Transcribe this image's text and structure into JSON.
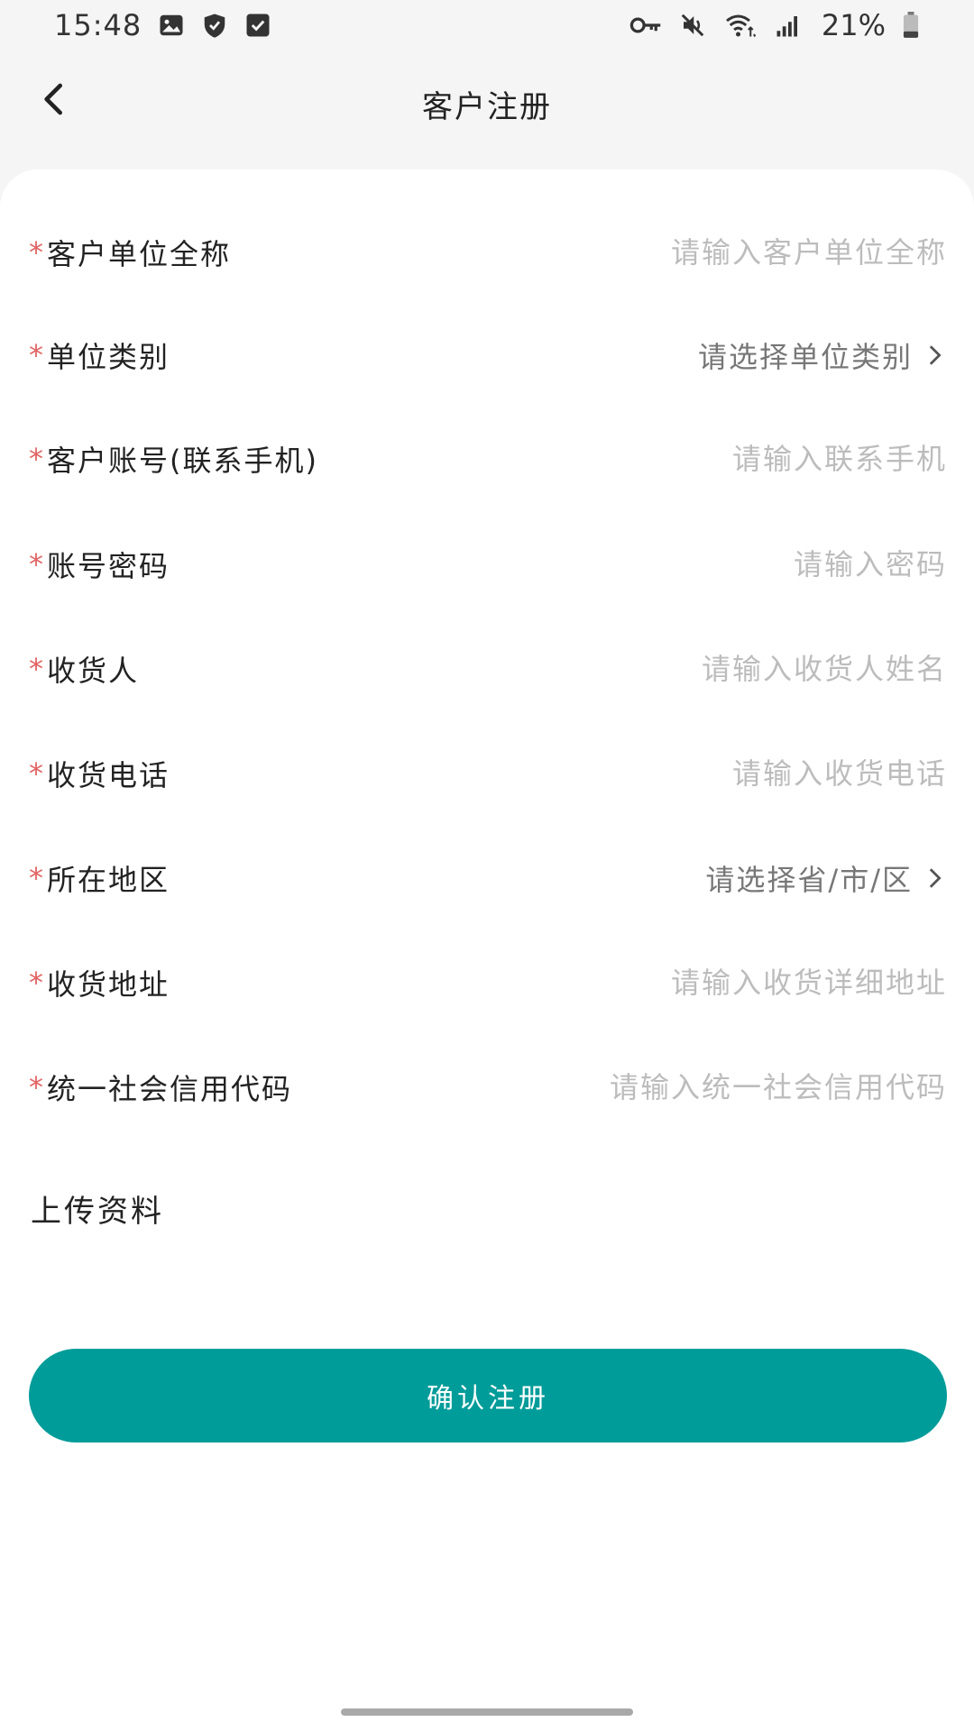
{
  "status_bar": {
    "time": "15:48",
    "battery": "21%",
    "icons_left": [
      "image-icon",
      "shield-icon",
      "check-box-icon"
    ],
    "icons_right": [
      "vpn-key-icon",
      "mute-icon",
      "wifi-icon",
      "signal-icon",
      "battery-icon"
    ]
  },
  "header": {
    "title": "客户注册",
    "back_icon": "chevron-left-icon"
  },
  "form": {
    "fields": [
      {
        "label": "客户单位全称",
        "required": "*",
        "type": "input",
        "placeholder": "请输入客户单位全称",
        "value": ""
      },
      {
        "label": "单位类别",
        "required": "*",
        "type": "select",
        "placeholder": "请选择单位类别",
        "value": ""
      },
      {
        "label": "客户账号(联系手机)",
        "required": "*",
        "type": "input",
        "placeholder": "请输入联系手机",
        "value": ""
      },
      {
        "label": "账号密码",
        "required": "*",
        "type": "input",
        "placeholder": "请输入密码",
        "value": ""
      },
      {
        "label": "收货人",
        "required": "*",
        "type": "input",
        "placeholder": "请输入收货人姓名",
        "value": ""
      },
      {
        "label": "收货电话",
        "required": "*",
        "type": "input",
        "placeholder": "请输入收货电话",
        "value": ""
      },
      {
        "label": "所在地区",
        "required": "*",
        "type": "select",
        "placeholder": "请选择省/市/区",
        "value": ""
      },
      {
        "label": "收货地址",
        "required": "*",
        "type": "input",
        "placeholder": "请输入收货详细地址",
        "value": ""
      },
      {
        "label": "统一社会信用代码",
        "required": "*",
        "type": "input",
        "placeholder": "请输入统一社会信用代码",
        "value": ""
      }
    ],
    "upload_label": "上传资料",
    "submit_label": "确认注册"
  },
  "colors": {
    "accent": "#009c9a",
    "required": "#e26464",
    "placeholder": "#bcbcbc",
    "background": "#f5f5f5"
  }
}
